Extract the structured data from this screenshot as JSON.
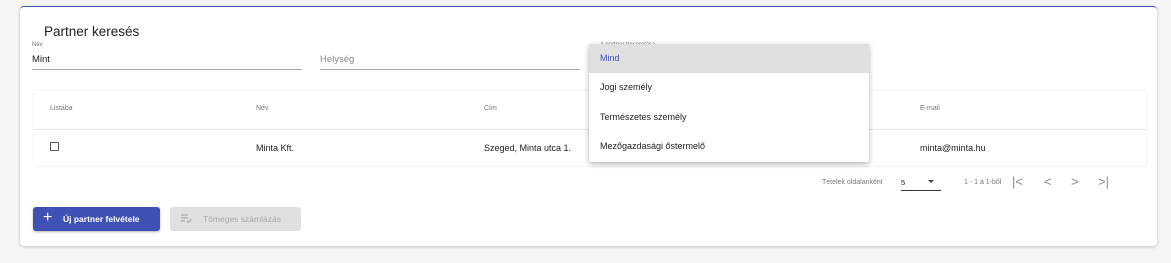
{
  "title": "Partner keresés",
  "filters": {
    "name_label": "Név",
    "name_value": "Mint",
    "city_placeholder": "Helység",
    "type_label": "A partner besorolása"
  },
  "type_dropdown": {
    "options": [
      "Mind",
      "Jogi személy",
      "Természetes személy",
      "Mezőgazdasági őstermelő"
    ],
    "selected": "Mind"
  },
  "table": {
    "headers": [
      "Listába",
      "Név",
      "Cím",
      "E-mail"
    ],
    "rows": [
      {
        "name": "Minta Kft.",
        "address": "Szeged, Minta utca 1.",
        "email": "minta@minta.hu",
        "checked": false
      }
    ]
  },
  "pagination": {
    "per_page_label": "Tételek oldalanként",
    "per_page_value": "5",
    "range_label": "1 - 1 a 1-ből",
    "first": "|<",
    "prev": "<",
    "next": ">",
    "last": ">|"
  },
  "buttons": {
    "new_partner": "Új partner felvétele",
    "bulk_invoice": "Tömeges számlázás"
  },
  "colors": {
    "primary": "#3f51b5",
    "disabled_bg": "#e0e0e0",
    "selected_option_bg": "#e0e0e0"
  }
}
